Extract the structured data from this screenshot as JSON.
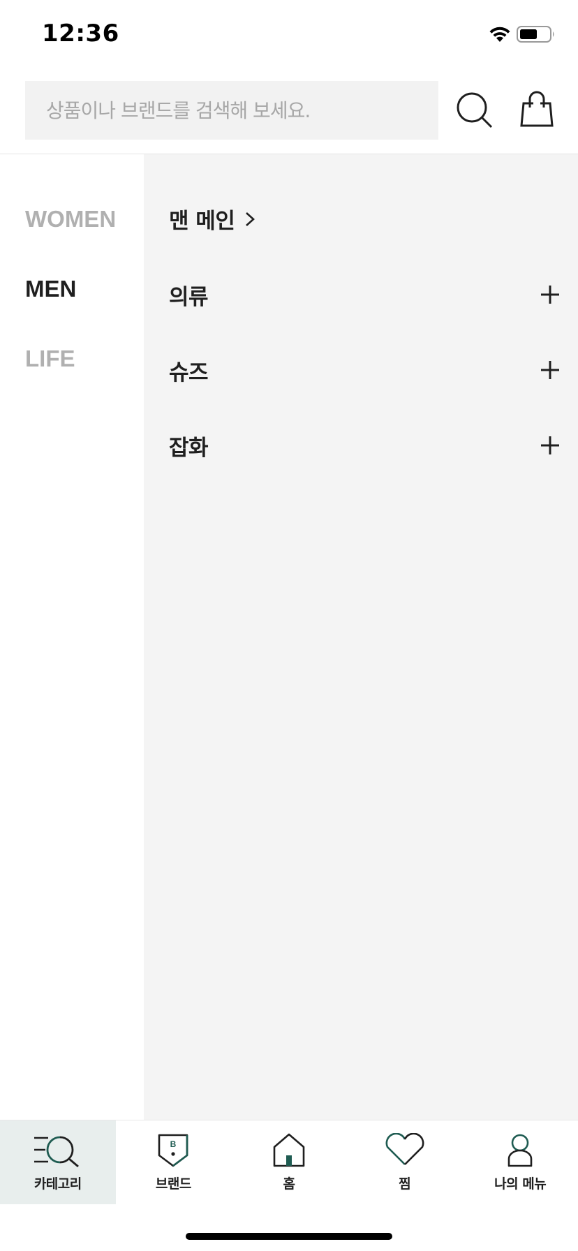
{
  "status_bar": {
    "time": "12:36",
    "icons": [
      "wifi-icon",
      "battery-icon"
    ]
  },
  "search": {
    "placeholder": "상품이나 브랜드를 검색해 보세요.",
    "value": "",
    "search_icon": "search-icon",
    "cart_icon": "shopping-bag-icon"
  },
  "gender_tabs": [
    {
      "label": "WOMEN",
      "active": false
    },
    {
      "label": "MEN",
      "active": true
    },
    {
      "label": "LIFE",
      "active": false
    }
  ],
  "panel": {
    "main_link": {
      "label": "맨 메인",
      "icon": "chevron-right-icon"
    },
    "categories": [
      {
        "label": "의류",
        "icon": "plus-icon"
      },
      {
        "label": "슈즈",
        "icon": "plus-icon"
      },
      {
        "label": "잡화",
        "icon": "plus-icon"
      }
    ]
  },
  "tab_bar": {
    "items": [
      {
        "label": "카테고리",
        "icon": "category-search-icon",
        "active": true
      },
      {
        "label": "브랜드",
        "icon": "brand-shield-icon",
        "active": false
      },
      {
        "label": "홈",
        "icon": "home-icon",
        "active": false
      },
      {
        "label": "찜",
        "icon": "heart-icon",
        "active": false
      },
      {
        "label": "나의 메뉴",
        "icon": "person-icon",
        "active": false
      }
    ]
  },
  "colors": {
    "accent": "#1f5c52",
    "text": "#1f1f1f",
    "muted": "#b0b0b0",
    "panel_bg": "#f4f4f4",
    "search_bg": "#f2f2f2",
    "active_tab_bg": "#e8eeed"
  }
}
